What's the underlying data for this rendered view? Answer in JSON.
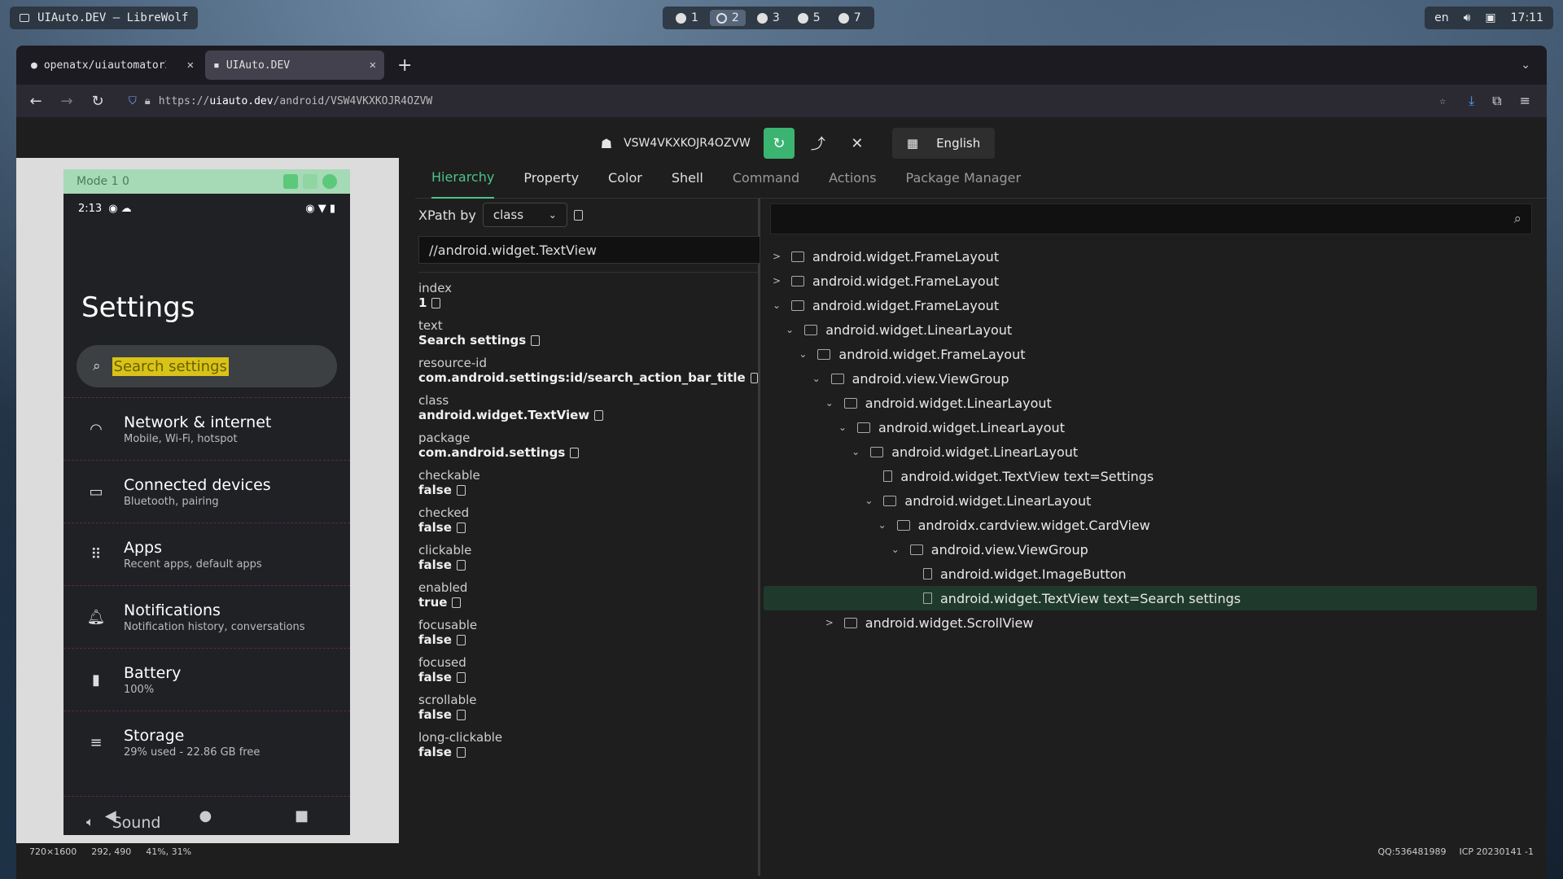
{
  "os": {
    "window_title": "UIAuto.DEV — LibreWolf",
    "workspaces": [
      "1",
      "2",
      "3",
      "5",
      "7"
    ],
    "active_workspace": "2",
    "locale": "en",
    "clock": "17:11"
  },
  "browser": {
    "tabs": [
      {
        "title": "openatx/uiautomator2"
      },
      {
        "title": "UIAuto.DEV"
      }
    ],
    "url_prefix": "https://",
    "url_host": "uiauto.dev",
    "url_path": "/android/VSW4VKXKOJR4OZVW"
  },
  "header": {
    "device_serial": "VSW4VKXKOJR4OZVW",
    "language": "English"
  },
  "phone": {
    "mode_label": "Mode 1 0",
    "time": "2:13",
    "title": "Settings",
    "search_placeholder": "Search settings",
    "items": [
      {
        "title": "Network & internet",
        "subtitle": "Mobile, Wi-Fi, hotspot",
        "icon": "wifi-icon"
      },
      {
        "title": "Connected devices",
        "subtitle": "Bluetooth, pairing",
        "icon": "devices-icon"
      },
      {
        "title": "Apps",
        "subtitle": "Recent apps, default apps",
        "icon": "apps-grid-icon"
      },
      {
        "title": "Notifications",
        "subtitle": "Notification history, conversations",
        "icon": "bell-icon"
      },
      {
        "title": "Battery",
        "subtitle": "100%",
        "icon": "battery-icon"
      },
      {
        "title": "Storage",
        "subtitle": "29% used - 22.86 GB free",
        "icon": "storage-icon"
      }
    ],
    "partial_item": "Sound"
  },
  "tabs": [
    "Hierarchy",
    "Property",
    "Color",
    "Shell",
    "Command",
    "Actions",
    "Package Manager"
  ],
  "active_tab": "Hierarchy",
  "xpath": {
    "label": "XPath by",
    "selected": "class",
    "value": "//android.widget.TextView"
  },
  "properties": [
    {
      "key": "index",
      "value": "1"
    },
    {
      "key": "text",
      "value": "Search settings"
    },
    {
      "key": "resource-id",
      "value": "com.android.settings:id/search_action_bar_title"
    },
    {
      "key": "class",
      "value": "android.widget.TextView"
    },
    {
      "key": "package",
      "value": "com.android.settings"
    },
    {
      "key": "checkable",
      "value": "false"
    },
    {
      "key": "checked",
      "value": "false"
    },
    {
      "key": "clickable",
      "value": "false"
    },
    {
      "key": "enabled",
      "value": "true"
    },
    {
      "key": "focusable",
      "value": "false"
    },
    {
      "key": "focused",
      "value": "false"
    },
    {
      "key": "scrollable",
      "value": "false"
    },
    {
      "key": "long-clickable",
      "value": "false"
    }
  ],
  "tree": [
    {
      "label": "android.widget.FrameLayout",
      "level": 0,
      "state": "collapsed",
      "type": "folder"
    },
    {
      "label": "android.widget.FrameLayout",
      "level": 0,
      "state": "collapsed",
      "type": "folder"
    },
    {
      "label": "android.widget.FrameLayout",
      "level": 0,
      "state": "expanded",
      "type": "folder"
    },
    {
      "label": "android.widget.LinearLayout",
      "level": 1,
      "state": "expanded",
      "type": "folder"
    },
    {
      "label": "android.widget.FrameLayout",
      "level": 2,
      "state": "expanded",
      "type": "folder"
    },
    {
      "label": "android.view.ViewGroup",
      "level": 3,
      "state": "expanded",
      "type": "folder"
    },
    {
      "label": "android.widget.LinearLayout",
      "level": 4,
      "state": "expanded",
      "type": "folder"
    },
    {
      "label": "android.widget.LinearLayout",
      "level": 5,
      "state": "expanded",
      "type": "folder"
    },
    {
      "label": "android.widget.LinearLayout",
      "level": 6,
      "state": "expanded",
      "type": "folder"
    },
    {
      "label": "android.widget.TextView text=Settings",
      "level": 7,
      "state": "leaf",
      "type": "file"
    },
    {
      "label": "android.widget.LinearLayout",
      "level": 7,
      "state": "expanded",
      "type": "folder"
    },
    {
      "label": "androidx.cardview.widget.CardView",
      "level": 8,
      "state": "expanded",
      "type": "folder"
    },
    {
      "label": "android.view.ViewGroup",
      "level": 9,
      "state": "expanded",
      "type": "folder"
    },
    {
      "label": "android.widget.ImageButton",
      "level": 10,
      "state": "leaf",
      "type": "file"
    },
    {
      "label": "android.widget.TextView text=Search settings",
      "level": 10,
      "state": "leaf",
      "type": "file",
      "selected": true
    },
    {
      "label": "android.widget.ScrollView",
      "level": 4,
      "state": "collapsed",
      "type": "folder"
    }
  ],
  "footer": {
    "resolution": "720×1600",
    "coords": "292, 490",
    "percent": "41%, 31%",
    "qq": "QQ:536481989",
    "icp": "ICP 20230141 -1"
  }
}
